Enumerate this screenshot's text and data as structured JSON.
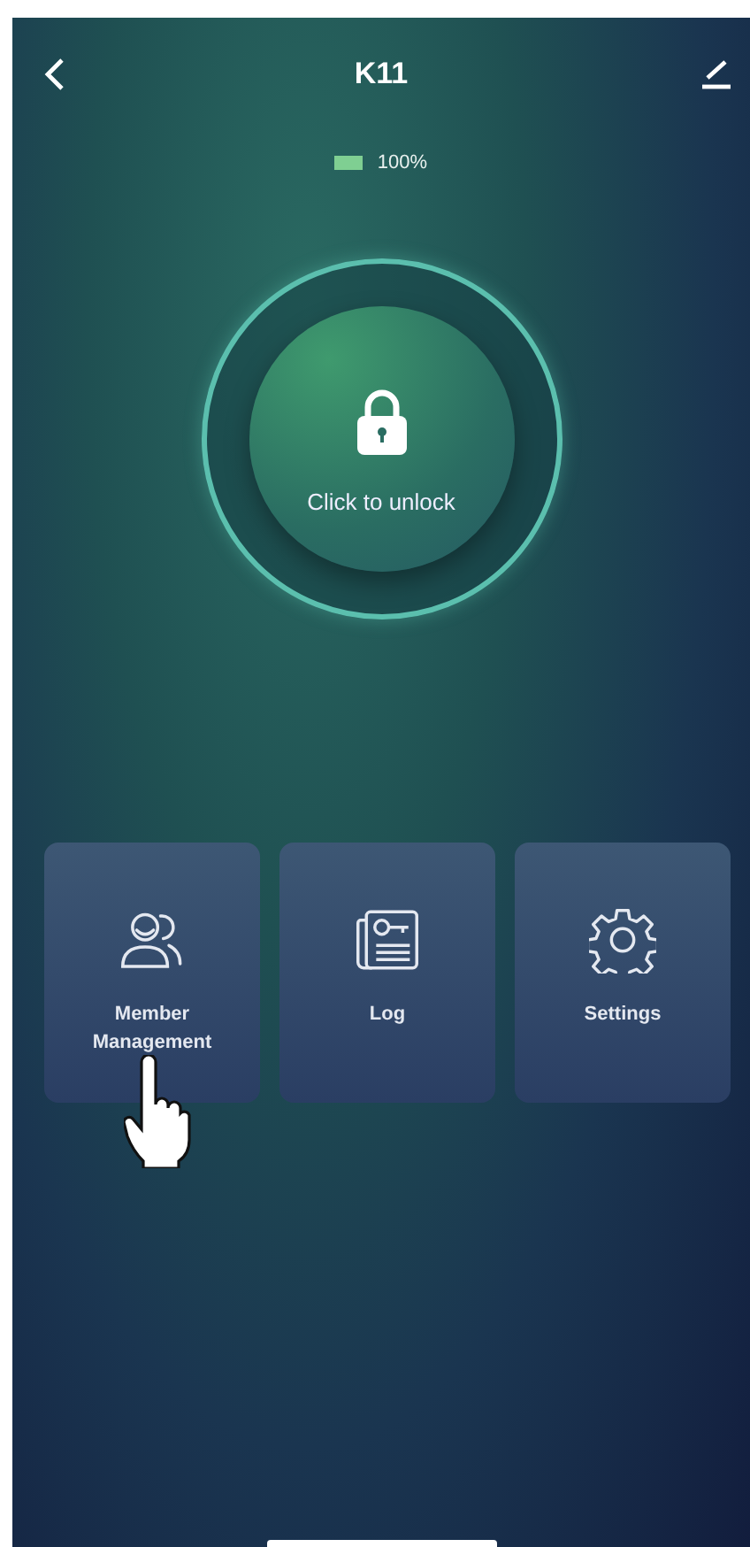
{
  "header": {
    "title": "K11"
  },
  "battery": {
    "reading": "100%"
  },
  "lock_button": {
    "label": "Click to unlock"
  },
  "tiles": [
    {
      "kind": "members",
      "label": "Member Management",
      "pointed": true
    },
    {
      "kind": "log",
      "label": "Log"
    },
    {
      "kind": "settings",
      "label": "Settings"
    }
  ]
}
